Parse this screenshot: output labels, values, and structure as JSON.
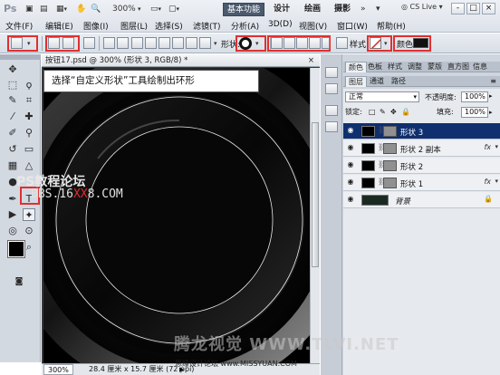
{
  "app": {
    "logo": "Ps",
    "zoom": "300%",
    "workspaces": [
      "基本功能",
      "设计",
      "绘画",
      "摄影"
    ],
    "cs_live": "CS Live",
    "window_controls": [
      "-",
      "□",
      "×"
    ]
  },
  "menu": [
    "文件(F)",
    "编辑(E)",
    "图像(I)",
    "图层(L)",
    "选择(S)",
    "滤镜(T)",
    "分析(A)",
    "3D(D)",
    "视图(V)",
    "窗口(W)",
    "帮助(H)"
  ],
  "options_bar": {
    "shape_label": "形状:",
    "style_label": "样式:",
    "color_label": "颜色:",
    "color_value": "#111111"
  },
  "document": {
    "tab_title": "按钮17.psd @ 300% (形状 3, RGB/8) *",
    "status_zoom": "300%",
    "status_info": "28.4 厘米 x 15.7 厘米 (72 ppi)"
  },
  "panels": {
    "top_tabs": [
      "颜色",
      "色板",
      "样式",
      "调整",
      "蒙版",
      "直方图",
      "信息"
    ],
    "layer_tabs": [
      "图层",
      "通道",
      "路径"
    ],
    "blend_mode": "正常",
    "opacity_label": "不透明度:",
    "opacity_value": "100%",
    "lock_label": "锁定:",
    "fill_label": "填充:",
    "fill_value": "100%",
    "layers": [
      {
        "name": "形状 3",
        "selected": true,
        "fx": false
      },
      {
        "name": "形状 2 副本",
        "selected": false,
        "fx": true
      },
      {
        "name": "形状 2",
        "selected": false,
        "fx": false
      },
      {
        "name": "形状 1",
        "selected": false,
        "fx": true
      },
      {
        "name": "背景",
        "selected": false,
        "fx": false
      }
    ]
  },
  "overlay": {
    "callout": "选择“自定义形状”工具绘制出环形",
    "watermark_1": "PS教程论坛",
    "watermark_2_pre": "BBS.16",
    "watermark_2_red": "XX",
    "watermark_2_post": "8.COM",
    "watermark_bottom": "腾龙视觉 WWW.TLVI.NET",
    "watermark_site": "思缘设计论坛 www.MISSYUAN.COM"
  }
}
